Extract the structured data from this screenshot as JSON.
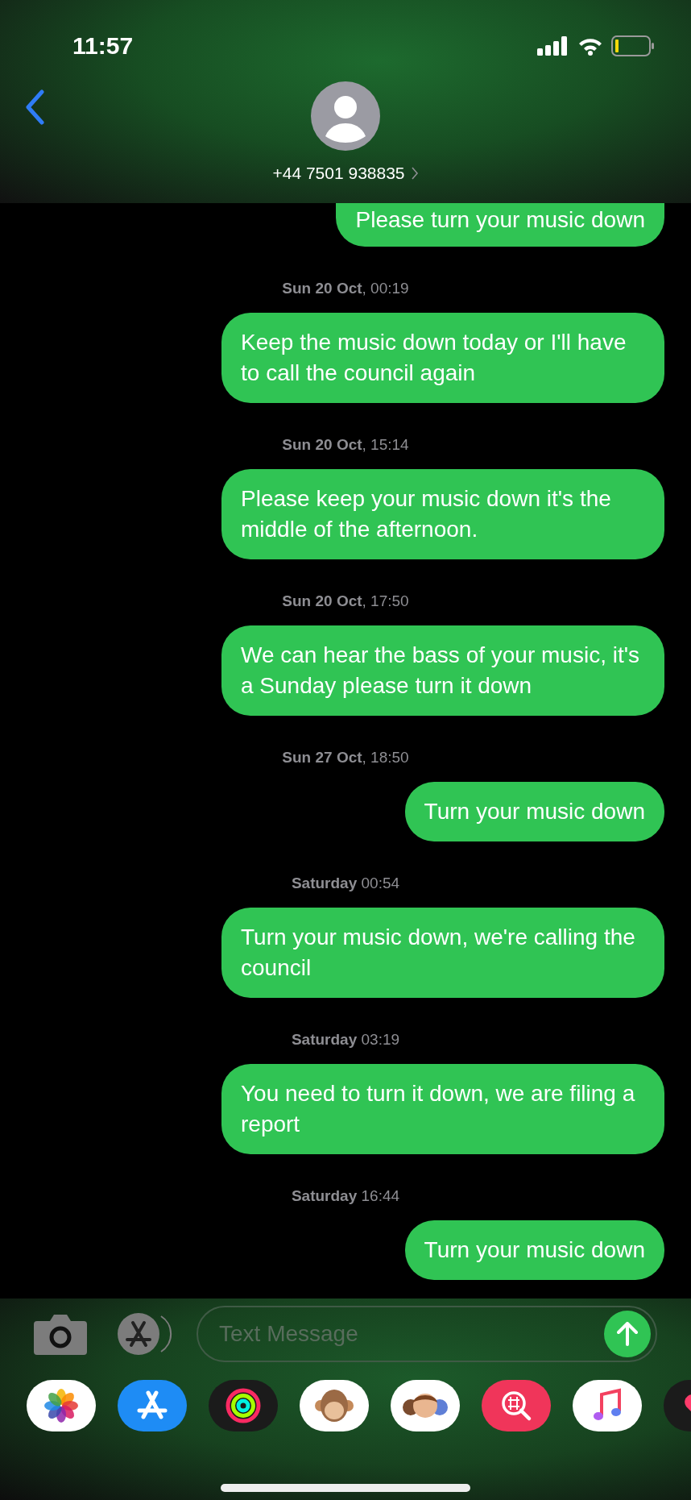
{
  "status_bar": {
    "time": "11:57"
  },
  "header": {
    "contact": "+44 7501 938835"
  },
  "thread": [
    {
      "kind": "message",
      "text": "Please turn your music down"
    },
    {
      "kind": "timestamp",
      "text": "**Sun 20 Oct**, 00:19"
    },
    {
      "kind": "message",
      "text": "Keep the music down today or I'll have to call the council again"
    },
    {
      "kind": "timestamp",
      "text": "**Sun 20 Oct**, 15:14"
    },
    {
      "kind": "message",
      "text": "Please keep your music down it's the middle of the afternoon."
    },
    {
      "kind": "timestamp",
      "text": "**Sun 20 Oct**, 17:50"
    },
    {
      "kind": "message",
      "text": "We can hear the bass of your music, it's a Sunday please turn it down"
    },
    {
      "kind": "timestamp",
      "text": "**Sun 27 Oct**, 18:50"
    },
    {
      "kind": "message",
      "text": "Turn your music down"
    },
    {
      "kind": "timestamp",
      "text": "**Saturday** 00:54"
    },
    {
      "kind": "message",
      "text": "Turn your music down, we're calling the council"
    },
    {
      "kind": "timestamp",
      "text": "**Saturday** 03:19"
    },
    {
      "kind": "message",
      "text": "You need to turn it down, we are filing a report"
    },
    {
      "kind": "timestamp",
      "text": "**Saturday** 16:44"
    },
    {
      "kind": "message",
      "text": "Turn your music down"
    }
  ],
  "composer": {
    "placeholder": "Text Message"
  }
}
